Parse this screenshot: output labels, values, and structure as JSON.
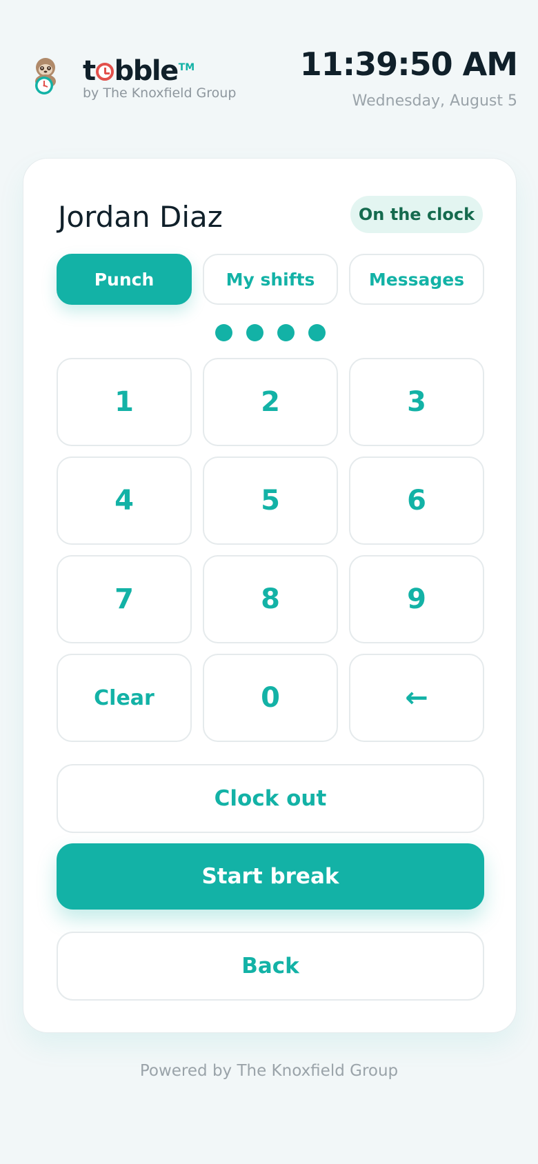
{
  "brand": {
    "logo_prefix": "t",
    "logo_suffix": "bble",
    "trademark": "TM",
    "subtitle": "by The Knoxfield Group",
    "accent_color": "#13b2a6"
  },
  "clock": {
    "time": "11:39:50 AM",
    "date": "Wednesday, August 5"
  },
  "employee": {
    "name": "Jordan Diaz",
    "status": "On the clock"
  },
  "tabs": [
    {
      "label": "Punch",
      "active": true
    },
    {
      "label": "My shifts",
      "active": false
    },
    {
      "label": "Messages",
      "active": false
    }
  ],
  "pin": {
    "entered_digits": 4
  },
  "keypad": {
    "keys": [
      "1",
      "2",
      "3",
      "4",
      "5",
      "6",
      "7",
      "8",
      "9",
      "Clear",
      "0",
      "←"
    ]
  },
  "actions": {
    "clock_out": "Clock out",
    "start_break": "Start break",
    "back": "Back"
  },
  "footer": {
    "text": "Powered by The Knoxfield Group"
  }
}
